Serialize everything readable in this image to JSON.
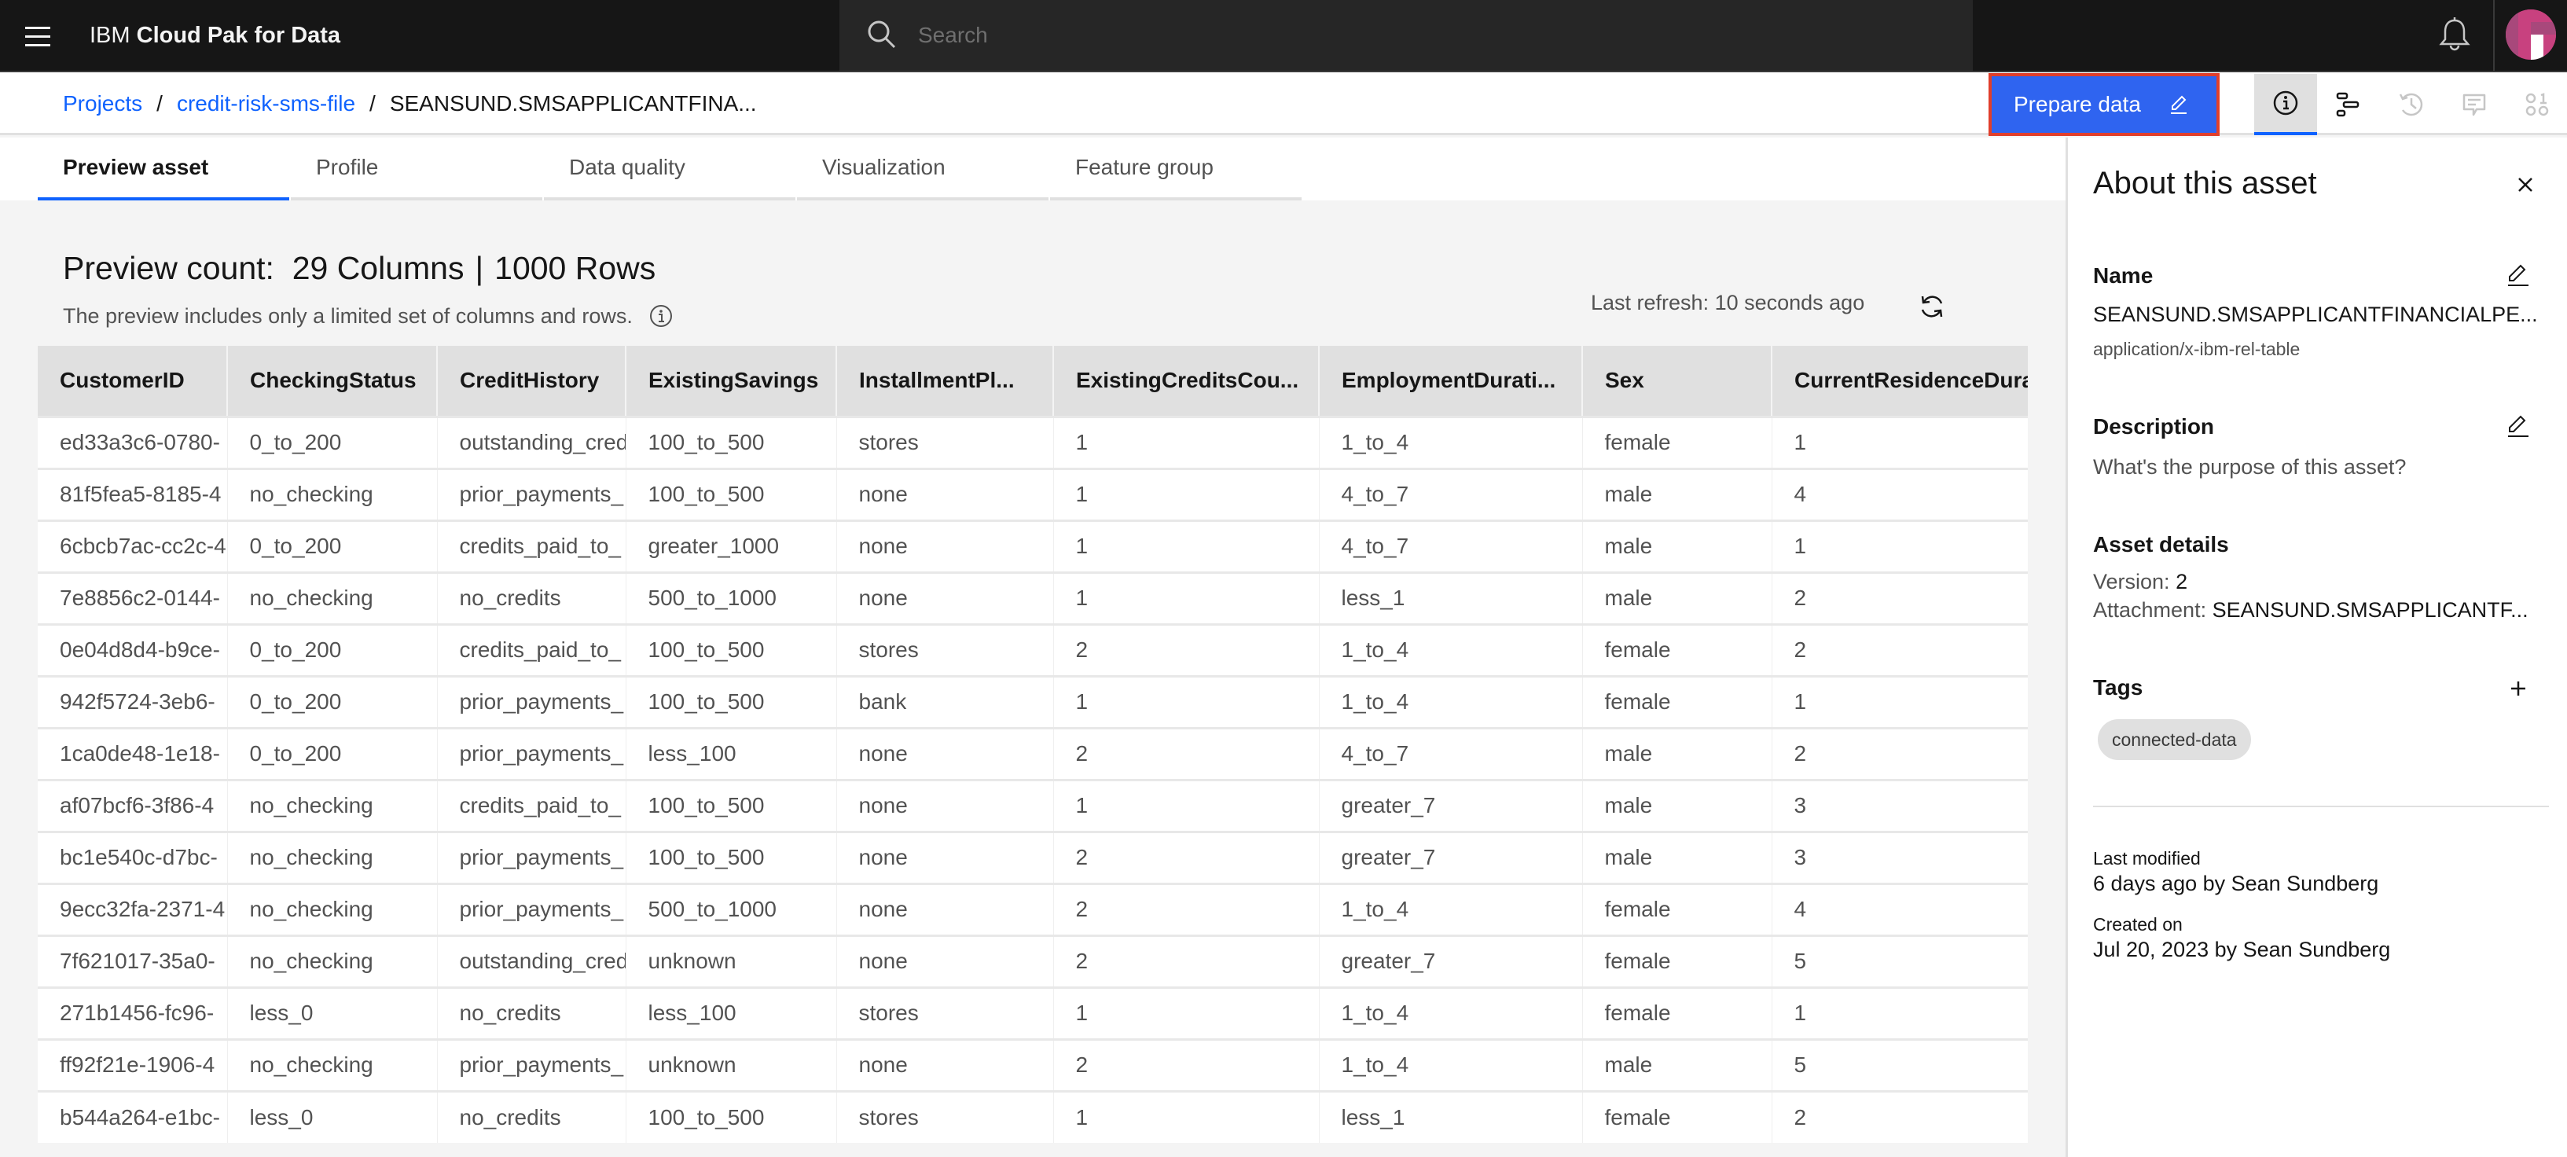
{
  "header": {
    "brand_prefix": "IBM",
    "brand_name": "Cloud Pak for Data",
    "search_placeholder": "Search",
    "icons": [
      "menu-icon",
      "search-icon",
      "notification-bell-icon",
      "user-avatar"
    ]
  },
  "breadcrumb": {
    "items": [
      {
        "label": "Projects",
        "link": true
      },
      {
        "label": "credit-risk-sms-file",
        "link": true
      },
      {
        "label": "SEANSUND.SMSAPPLICANTFINA...",
        "link": false
      }
    ],
    "separator": "/"
  },
  "toolbar": {
    "prepare_label": "Prepare data",
    "prepare_icon": "edit-icon",
    "tools": [
      {
        "name": "info-icon",
        "active": true
      },
      {
        "name": "lineage-icon",
        "active": false
      },
      {
        "name": "history-icon",
        "active": false,
        "disabled": true
      },
      {
        "name": "comment-icon",
        "active": false,
        "disabled": true
      },
      {
        "name": "data-class-icon",
        "active": false,
        "disabled": true
      }
    ]
  },
  "tabs": [
    {
      "label": "Preview asset",
      "active": true
    },
    {
      "label": "Profile",
      "active": false
    },
    {
      "label": "Data quality",
      "active": false
    },
    {
      "label": "Visualization",
      "active": false
    },
    {
      "label": "Feature group",
      "active": false
    }
  ],
  "preview": {
    "title_prefix": "Preview count:",
    "columns_text": "29 Columns",
    "divider": "|",
    "rows_text": "1000 Rows",
    "subtitle": "The preview includes only a limited set of columns and rows.",
    "last_refresh": "Last refresh: 10 seconds ago"
  },
  "table": {
    "columns": [
      "CustomerID",
      "CheckingStatus",
      "CreditHistory",
      "ExistingSavings",
      "InstallmentPl...",
      "ExistingCreditsCou...",
      "EmploymentDurati...",
      "Sex",
      "CurrentResidenceDura"
    ],
    "rows": [
      [
        "ed33a3c6-0780-",
        "0_to_200",
        "outstanding_cred",
        "100_to_500",
        "stores",
        "1",
        "1_to_4",
        "female",
        "1"
      ],
      [
        "81f5fea5-8185-4",
        "no_checking",
        "prior_payments_",
        "100_to_500",
        "none",
        "1",
        "4_to_7",
        "male",
        "4"
      ],
      [
        "6cbcb7ac-cc2c-4",
        "0_to_200",
        "credits_paid_to_",
        "greater_1000",
        "none",
        "1",
        "4_to_7",
        "male",
        "1"
      ],
      [
        "7e8856c2-0144-",
        "no_checking",
        "no_credits",
        "500_to_1000",
        "none",
        "1",
        "less_1",
        "male",
        "2"
      ],
      [
        "0e04d8d4-b9ce-",
        "0_to_200",
        "credits_paid_to_",
        "100_to_500",
        "stores",
        "2",
        "1_to_4",
        "female",
        "2"
      ],
      [
        "942f5724-3eb6-",
        "0_to_200",
        "prior_payments_",
        "100_to_500",
        "bank",
        "1",
        "1_to_4",
        "female",
        "1"
      ],
      [
        "1ca0de48-1e18-",
        "0_to_200",
        "prior_payments_",
        "less_100",
        "none",
        "2",
        "4_to_7",
        "male",
        "2"
      ],
      [
        "af07bcf6-3f86-4",
        "no_checking",
        "credits_paid_to_",
        "100_to_500",
        "none",
        "1",
        "greater_7",
        "male",
        "3"
      ],
      [
        "bc1e540c-d7bc-",
        "no_checking",
        "prior_payments_",
        "100_to_500",
        "none",
        "2",
        "greater_7",
        "male",
        "3"
      ],
      [
        "9ecc32fa-2371-4",
        "no_checking",
        "prior_payments_",
        "500_to_1000",
        "none",
        "2",
        "1_to_4",
        "female",
        "4"
      ],
      [
        "7f621017-35a0-",
        "no_checking",
        "outstanding_cred",
        "unknown",
        "none",
        "2",
        "greater_7",
        "female",
        "5"
      ],
      [
        "271b1456-fc96-",
        "less_0",
        "no_credits",
        "less_100",
        "stores",
        "1",
        "1_to_4",
        "female",
        "1"
      ],
      [
        "ff92f21e-1906-4",
        "no_checking",
        "prior_payments_",
        "unknown",
        "none",
        "2",
        "1_to_4",
        "male",
        "5"
      ],
      [
        "b544a264-e1bc-",
        "less_0",
        "no_credits",
        "100_to_500",
        "stores",
        "1",
        "less_1",
        "female",
        "2"
      ]
    ]
  },
  "panel": {
    "title": "About this asset",
    "name_label": "Name",
    "name_value": "SEANSUND.SMSAPPLICANTFINANCIALPE...",
    "name_type": "application/x-ibm-rel-table",
    "description_label": "Description",
    "description_placeholder": "What's the purpose of this asset?",
    "details_label": "Asset details",
    "version_label": "Version:",
    "version_value": "2",
    "attachment_label": "Attachment:",
    "attachment_value": "SEANSUND.SMSAPPLICANTF...",
    "tags_label": "Tags",
    "tags": [
      "connected-data"
    ],
    "last_modified_label": "Last modified",
    "last_modified_value": "6 days ago by Sean Sundberg",
    "created_label": "Created on",
    "created_value": "Jul 20, 2023 by Sean Sundberg"
  },
  "colors": {
    "accent": "#0f62fe",
    "prepare_button": "#2f64f0",
    "highlight_outline": "#e03f2c",
    "header_bg": "#161616"
  }
}
